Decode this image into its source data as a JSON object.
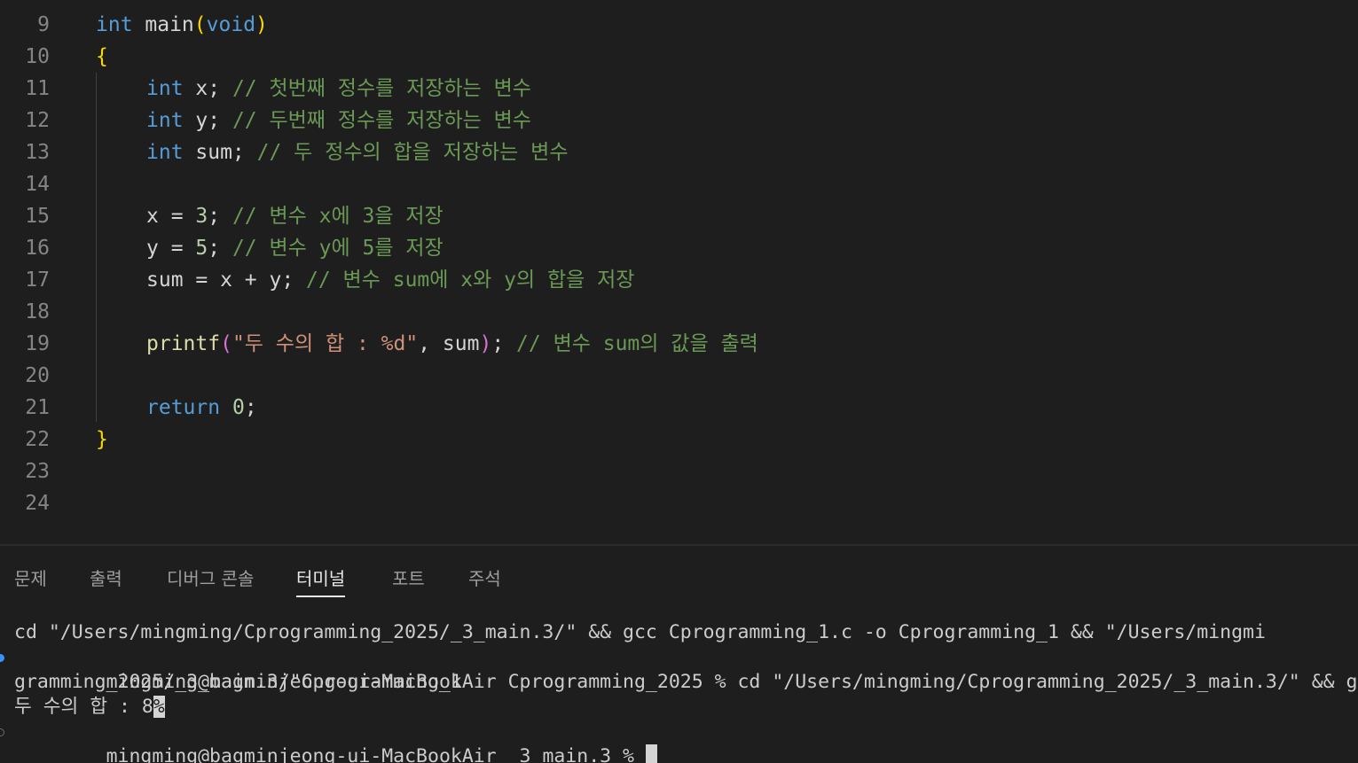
{
  "editor": {
    "lines": [
      {
        "n": "9",
        "tokens": [
          [
            "kw",
            "int"
          ],
          [
            "pl",
            " main"
          ],
          [
            "br1",
            "("
          ],
          [
            "kw",
            "void"
          ],
          [
            "br1",
            ")"
          ]
        ]
      },
      {
        "n": "10",
        "tokens": [
          [
            "br1",
            "{"
          ]
        ]
      },
      {
        "n": "11",
        "indent": true,
        "tokens": [
          [
            "kw",
            "int"
          ],
          [
            "pl",
            " x; "
          ],
          [
            "cm",
            "// 첫번째 정수를 저장하는 변수"
          ]
        ]
      },
      {
        "n": "12",
        "indent": true,
        "tokens": [
          [
            "kw",
            "int"
          ],
          [
            "pl",
            " y; "
          ],
          [
            "cm",
            "// 두번째 정수를 저장하는 변수"
          ]
        ]
      },
      {
        "n": "13",
        "indent": true,
        "tokens": [
          [
            "kw",
            "int"
          ],
          [
            "pl",
            " sum; "
          ],
          [
            "cm",
            "// 두 정수의 합을 저장하는 변수"
          ]
        ]
      },
      {
        "n": "14",
        "tokens": []
      },
      {
        "n": "15",
        "indent": true,
        "tokens": [
          [
            "pl",
            "x = "
          ],
          [
            "num",
            "3"
          ],
          [
            "pl",
            "; "
          ],
          [
            "cm",
            "// 변수 x에 3을 저장"
          ]
        ]
      },
      {
        "n": "16",
        "indent": true,
        "tokens": [
          [
            "pl",
            "y = "
          ],
          [
            "num",
            "5"
          ],
          [
            "pl",
            "; "
          ],
          [
            "cm",
            "// 변수 y에 5를 저장"
          ]
        ]
      },
      {
        "n": "17",
        "indent": true,
        "tokens": [
          [
            "pl",
            "sum = x + y; "
          ],
          [
            "cm",
            "// 변수 sum에 x와 y의 합을 저장"
          ]
        ]
      },
      {
        "n": "18",
        "tokens": []
      },
      {
        "n": "19",
        "indent": true,
        "tokens": [
          [
            "fn",
            "printf"
          ],
          [
            "br2",
            "("
          ],
          [
            "str",
            "\"두 수의 합 : %d\""
          ],
          [
            "pl",
            ", sum"
          ],
          [
            "br2",
            ")"
          ],
          [
            "pl",
            "; "
          ],
          [
            "cm",
            "// 변수 sum의 값을 출력"
          ]
        ]
      },
      {
        "n": "20",
        "tokens": []
      },
      {
        "n": "21",
        "indent": true,
        "tokens": [
          [
            "kw",
            "return"
          ],
          [
            "pl",
            " "
          ],
          [
            "num",
            "0"
          ],
          [
            "pl",
            ";"
          ]
        ]
      },
      {
        "n": "22",
        "tokens": [
          [
            "br1",
            "}"
          ]
        ]
      },
      {
        "n": "23",
        "tokens": []
      },
      {
        "n": "24",
        "tokens": []
      }
    ]
  },
  "panel": {
    "tabs": [
      {
        "label": "문제",
        "active": false
      },
      {
        "label": "출력",
        "active": false
      },
      {
        "label": "디버그 콘솔",
        "active": false
      },
      {
        "label": "터미널",
        "active": true
      },
      {
        "label": "포트",
        "active": false
      },
      {
        "label": "주석",
        "active": false
      }
    ]
  },
  "terminal": {
    "line1": "cd \"/Users/mingming/Cprogramming_2025/_3_main.3/\" && gcc Cprogramming_1.c -o Cprogramming_1 && \"/Users/mingmi",
    "line2": "mingming@bagminjeong-ui-MacBookAir Cprogramming_2025 % cd \"/Users/mingming/Cprogramming_2025/_3_main.3/\" && g",
    "line3": "gramming_2025/_3_main.3/\"Cprogramming_1",
    "line4_text": "두 수의 합 : 8",
    "line4_marker": "%",
    "line5": "mingming@bagminjeong-ui-MacBookAir _3_main.3 % "
  },
  "colors": {
    "background": "#1e1e1e",
    "keyword": "#569cd6",
    "comment": "#6a9955",
    "number": "#b5cea8",
    "string": "#ce9178",
    "function": "#dcdcaa",
    "bracket_gold": "#ffd700",
    "bracket_pink": "#da70d6"
  },
  "icons": {
    "terminal_decoration_success": "circle-dot-icon",
    "terminal_decoration_default": "circle-outline-icon"
  }
}
